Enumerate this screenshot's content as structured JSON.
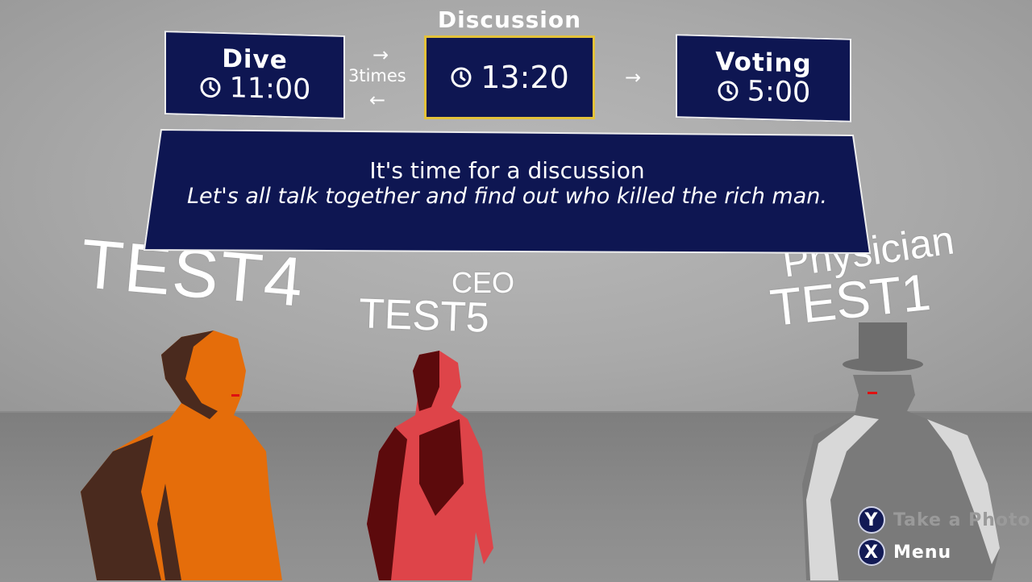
{
  "phases": {
    "dive": {
      "title": "Dive",
      "time": "11:00"
    },
    "discussion": {
      "title": "Discussion",
      "time": "13:20"
    },
    "voting": {
      "title": "Voting",
      "time": "5:00"
    },
    "loop_label": "3times",
    "current": "Discussion"
  },
  "message": {
    "line1": "It's time for a discussion",
    "line2": "Let's all talk together and find out who killed the rich man."
  },
  "characters": [
    {
      "role": "",
      "name": "TEST4",
      "color": "#e56d0a"
    },
    {
      "role": "CEO",
      "name": "TEST5",
      "color": "#de4449"
    },
    {
      "role": "Physician",
      "name": "TEST1",
      "color": "#7a7a7a"
    }
  ],
  "hints": {
    "photo": {
      "button": "Y",
      "label": "Take a Photo"
    },
    "menu": {
      "button": "X",
      "label": "Menu"
    }
  },
  "colors": {
    "panel": "#0e1652",
    "highlight": "#e3c23a",
    "wall": "#b0b0b0",
    "floor": "#858585"
  }
}
